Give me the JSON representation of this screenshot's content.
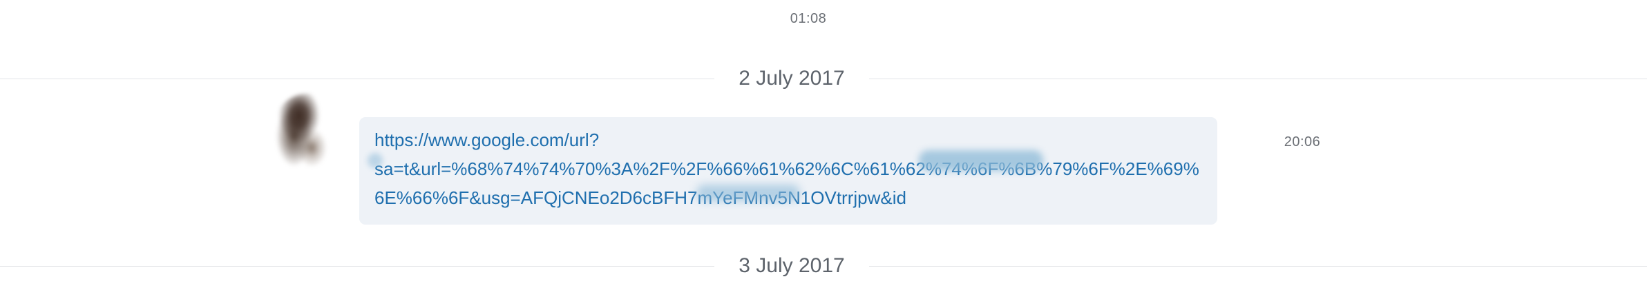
{
  "timestamps": {
    "top": "01:08",
    "message": "20:06"
  },
  "date_separators": [
    "2 July 2017",
    "3 July 2017"
  ],
  "message": {
    "link_text": "https://www.google.com/url?\nsa=t&url=%68%74%74%70%3A%2F%2F%66%61%62%6C%61%62%74%6F%6B%79%6F%2E%69%6E%66%6F&usg=AFQjCNEo2D6cBFH7mYeFMnv5N1OVtrrjpw&id"
  },
  "colors": {
    "link": "#1f6fae",
    "bubble_background": "#eef2f7",
    "timestamp_text": "#6b6f75",
    "date_text": "#5d636b",
    "separator_line": "#e2e4e7"
  }
}
